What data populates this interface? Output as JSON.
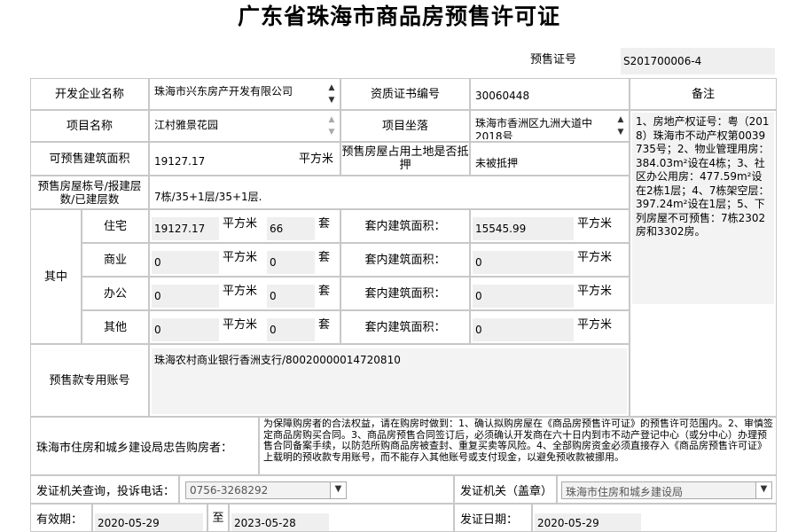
{
  "title": "广东省珠海市商品房预售许可证",
  "permit": {
    "label": "预售证号",
    "value": "S201700006-4"
  },
  "developer": {
    "label": "开发企业名称",
    "value": "珠海市兴东房产开发有限公司"
  },
  "cert_no": {
    "label": "资质证书编号",
    "value": "30060448"
  },
  "remarks_label": "备注",
  "project": {
    "label": "项目名称",
    "value": "江村雅景花园"
  },
  "location": {
    "label": "项目坐落",
    "value": "珠海市香洲区九洲大道中2018号"
  },
  "area": {
    "label": "可预售建筑面积",
    "value": "19127.17",
    "unit": "平方米"
  },
  "land": {
    "label": "预售房屋占用土地是否抵押",
    "value": "未被抵押"
  },
  "building": {
    "label": "预售房屋栋号/报建层数/已建层数",
    "value": "7栋/35+1层/35+1层."
  },
  "among_label": "其中",
  "rows": [
    {
      "type": "住宅",
      "area": "19127.17",
      "count": "66",
      "inner": "15545.99"
    },
    {
      "type": "商业",
      "area": "0",
      "count": "0",
      "inner": "0"
    },
    {
      "type": "办公",
      "area": "0",
      "count": "0",
      "inner": "0"
    },
    {
      "type": "其他",
      "area": "0",
      "count": "0",
      "inner": "0"
    }
  ],
  "units": {
    "sqm": "平方米",
    "set": "套",
    "inner_label": "套内建筑面积："
  },
  "remarks": "1、房地产权证号：粤（2018）珠海市不动产权第0039735号；2、物业管理用房：384.03m²设在4栋；3、社区办公用房：477.59m²设在2栋1层；4、7栋架空层：397.24m²设在1层；5、下列房屋不可预售：7栋2302房和3302房。",
  "account": {
    "label": "预售款专用账号",
    "value": "珠海农村商业银行香洲支行/80020000014720810"
  },
  "notice": {
    "label": "珠海市住房和城乡建设局忠告购房者：",
    "text": "为保障购房者的合法权益，请在购房时做到：1、确认拟购房屋在《商品房预售许可证》的预售许可范围内。2、审慎签定商品房购买合同。3、商品房预售合同签订后，必须确认开发商在六十日内到市不动产登记中心（或分中心）办理预售合同备案手续，以防范所购商品房被查封、重复买卖等风险。4、全部购房资金必须直接存入《商品房预售许可证》上载明的预收款专用账号，而不能存入其他账号或支付现金，以避免预收款被挪用。"
  },
  "complaint": {
    "label": "发证机关查询，投诉电话：",
    "value": "0756-3268292"
  },
  "issuer": {
    "label": "发证机关（盖章）",
    "value": "珠海市住房和城乡建设局"
  },
  "validity": {
    "label": "有效期：",
    "from": "2020-05-29",
    "to_label": "至",
    "to": "2023-05-28"
  },
  "issue_date": {
    "label": "发证日期：",
    "value": "2020-05-29"
  }
}
